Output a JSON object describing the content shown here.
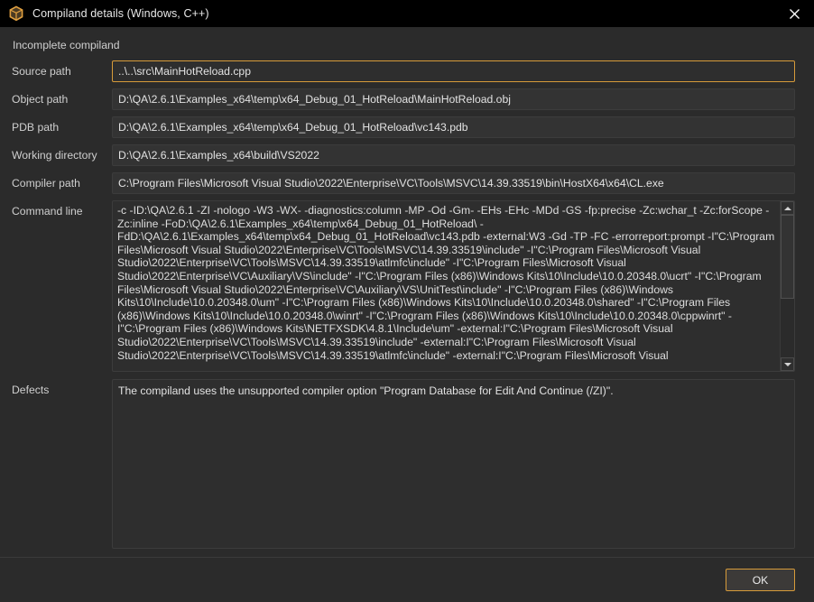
{
  "window": {
    "title": "Compiland details (Windows, C++)",
    "icon": "hexagon-box-icon",
    "close_label": "✕",
    "accent_color": "#d79b3a",
    "background_color": "#2b2b2b",
    "titlebar_color": "#000000"
  },
  "group": {
    "title": "Incomplete compiland"
  },
  "fields": {
    "source_path": {
      "label": "Source path",
      "value": "..\\..\\src\\MainHotReload.cpp",
      "focused": true
    },
    "object_path": {
      "label": "Object path",
      "value": "D:\\QA\\2.6.1\\Examples_x64\\temp\\x64_Debug_01_HotReload\\MainHotReload.obj",
      "focused": false
    },
    "pdb_path": {
      "label": "PDB path",
      "value": "D:\\QA\\2.6.1\\Examples_x64\\temp\\x64_Debug_01_HotReload\\vc143.pdb",
      "focused": false
    },
    "working_directory": {
      "label": "Working directory",
      "value": "D:\\QA\\2.6.1\\Examples_x64\\build\\VS2022",
      "focused": false
    },
    "compiler_path": {
      "label": "Compiler path",
      "value": "C:\\Program Files\\Microsoft Visual Studio\\2022\\Enterprise\\VC\\Tools\\MSVC\\14.39.33519\\bin\\HostX64\\x64\\CL.exe",
      "focused": false
    },
    "command_line": {
      "label": "Command line",
      "value": "-c -ID:\\QA\\2.6.1 -ZI -nologo -W3 -WX- -diagnostics:column -MP -Od -Gm- -EHs -EHc -MDd -GS -fp:precise -Zc:wchar_t -Zc:forScope -Zc:inline -FoD:\\QA\\2.6.1\\Examples_x64\\temp\\x64_Debug_01_HotReload\\ -FdD:\\QA\\2.6.1\\Examples_x64\\temp\\x64_Debug_01_HotReload\\vc143.pdb -external:W3 -Gd -TP -FC -errorreport:prompt -I\"C:\\Program Files\\Microsoft Visual Studio\\2022\\Enterprise\\VC\\Tools\\MSVC\\14.39.33519\\include\" -I\"C:\\Program Files\\Microsoft Visual Studio\\2022\\Enterprise\\VC\\Tools\\MSVC\\14.39.33519\\atlmfc\\include\" -I\"C:\\Program Files\\Microsoft Visual Studio\\2022\\Enterprise\\VC\\Auxiliary\\VS\\include\" -I\"C:\\Program Files (x86)\\Windows Kits\\10\\Include\\10.0.20348.0\\ucrt\" -I\"C:\\Program Files\\Microsoft Visual Studio\\2022\\Enterprise\\VC\\Auxiliary\\VS\\UnitTest\\include\" -I\"C:\\Program Files (x86)\\Windows Kits\\10\\Include\\10.0.20348.0\\um\" -I\"C:\\Program Files (x86)\\Windows Kits\\10\\Include\\10.0.20348.0\\shared\" -I\"C:\\Program Files (x86)\\Windows Kits\\10\\Include\\10.0.20348.0\\winrt\" -I\"C:\\Program Files (x86)\\Windows Kits\\10\\Include\\10.0.20348.0\\cppwinrt\" -I\"C:\\Program Files (x86)\\Windows Kits\\NETFXSDK\\4.8.1\\Include\\um\" -external:I\"C:\\Program Files\\Microsoft Visual Studio\\2022\\Enterprise\\VC\\Tools\\MSVC\\14.39.33519\\include\" -external:I\"C:\\Program Files\\Microsoft Visual Studio\\2022\\Enterprise\\VC\\Tools\\MSVC\\14.39.33519\\atlmfc\\include\" -external:I\"C:\\Program Files\\Microsoft Visual",
      "focused": false
    },
    "defects": {
      "label": "Defects",
      "value": "The compiland uses the unsupported compiler option \"Program Database for Edit And Continue (/ZI)\".",
      "focused": false
    }
  },
  "scrollbar": {
    "up_icon": "arrow-up-icon",
    "down_icon": "arrow-down-icon",
    "thumb_position_percent": 0,
    "thumb_size_percent": 59
  },
  "footer": {
    "ok_label": "OK"
  }
}
